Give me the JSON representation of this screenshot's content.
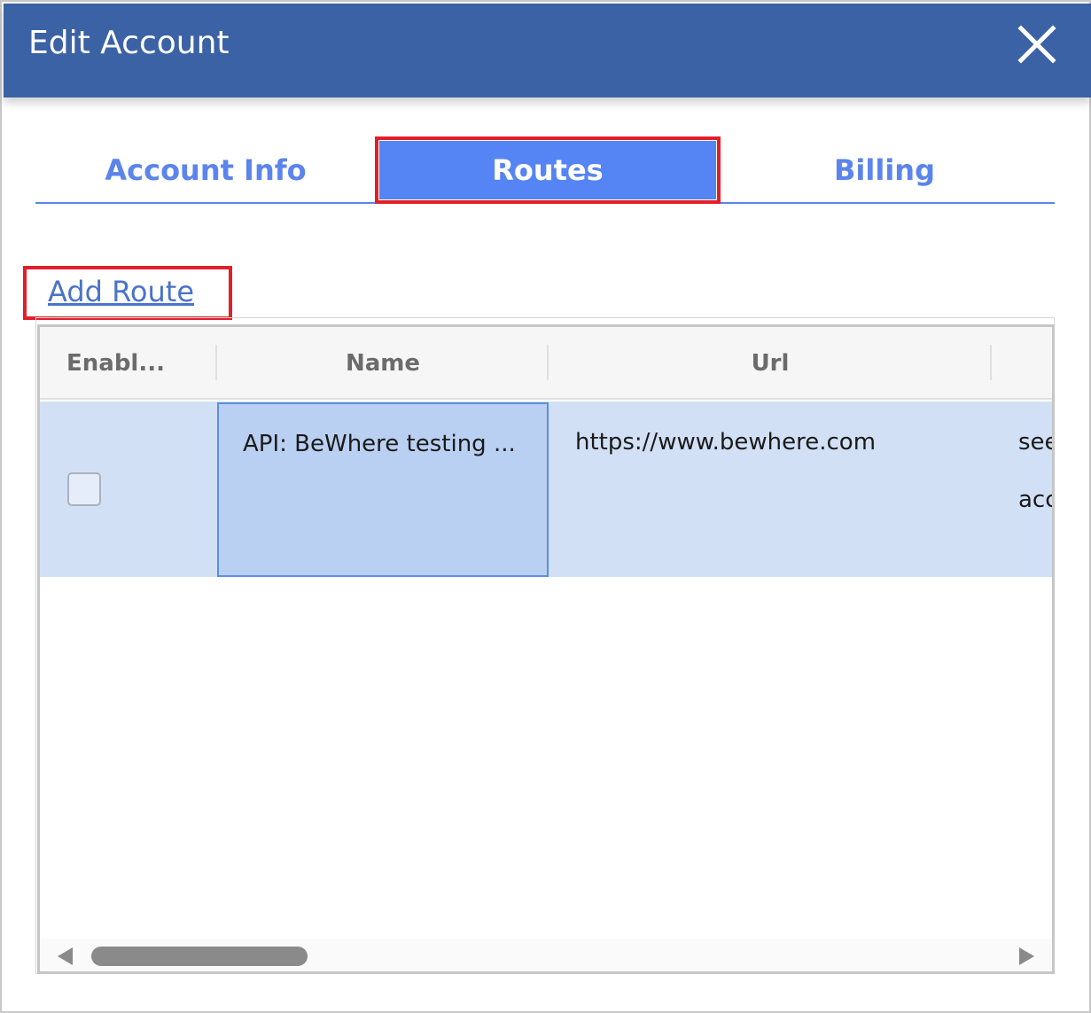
{
  "dialog": {
    "title": "Edit Account",
    "close_icon": "close-icon"
  },
  "tabs": [
    {
      "label": "Account Info",
      "active": false
    },
    {
      "label": "Routes",
      "active": true
    },
    {
      "label": "Billing",
      "active": false
    }
  ],
  "actions": {
    "add_route": "Add Route"
  },
  "grid": {
    "columns": [
      "Enabl...",
      "Name",
      "Url"
    ],
    "rows": [
      {
        "enabled": false,
        "name": "API: BeWhere testing ...",
        "url": "https://www.bewhere.com",
        "extra_line1": "see",
        "extra_line2": "acc"
      }
    ]
  },
  "colors": {
    "titlebar": "#3b62a5",
    "accent": "#5b84ec",
    "active_tab": "#5584f4",
    "highlight_border": "#e31e2b",
    "selected_row": "#d2e0f6",
    "selected_cell": "#bad0f2"
  }
}
